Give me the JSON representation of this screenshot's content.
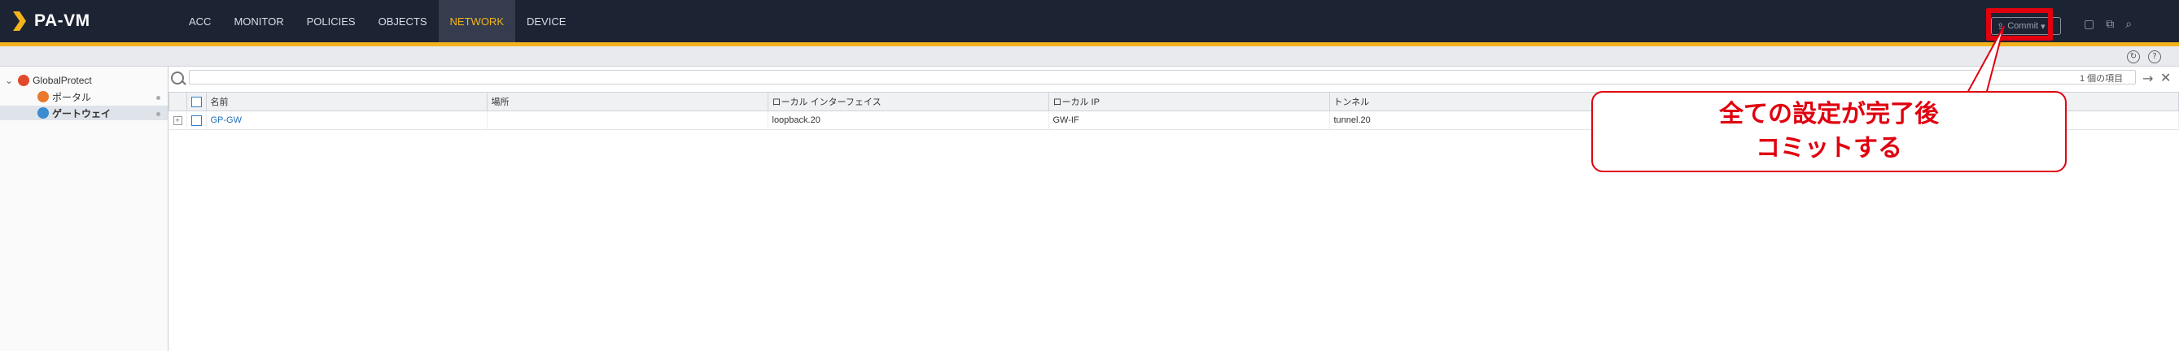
{
  "app": {
    "title": "PA-VM"
  },
  "nav": {
    "items": [
      "ACC",
      "MONITOR",
      "POLICIES",
      "OBJECTS",
      "NETWORK",
      "DEVICE"
    ],
    "active_index": 4
  },
  "toolbar": {
    "commit_label": "Commit"
  },
  "sidebar": {
    "root_label": "GlobalProtect",
    "items": [
      {
        "label": "ポータル",
        "selected": false
      },
      {
        "label": "ゲートウェイ",
        "selected": true
      }
    ]
  },
  "search": {
    "placeholder": "",
    "value": "",
    "result_count": "1 個の項目"
  },
  "table": {
    "headers": [
      "名前",
      "場所",
      "ローカル インターフェイス",
      "ローカル IP",
      "トンネル"
    ],
    "rows": [
      {
        "name": "GP-GW",
        "location": "",
        "local_interface": "loopback.20",
        "local_ip": "GW-IF",
        "tunnel": "tunnel.20"
      }
    ]
  },
  "callout": {
    "line1": "全ての設定が完了後",
    "line2": "コミットする"
  },
  "colors": {
    "topbar": "#1c2333",
    "accent": "#f4b31c",
    "highlight": "#e0000f",
    "link": "#1f6fba"
  }
}
